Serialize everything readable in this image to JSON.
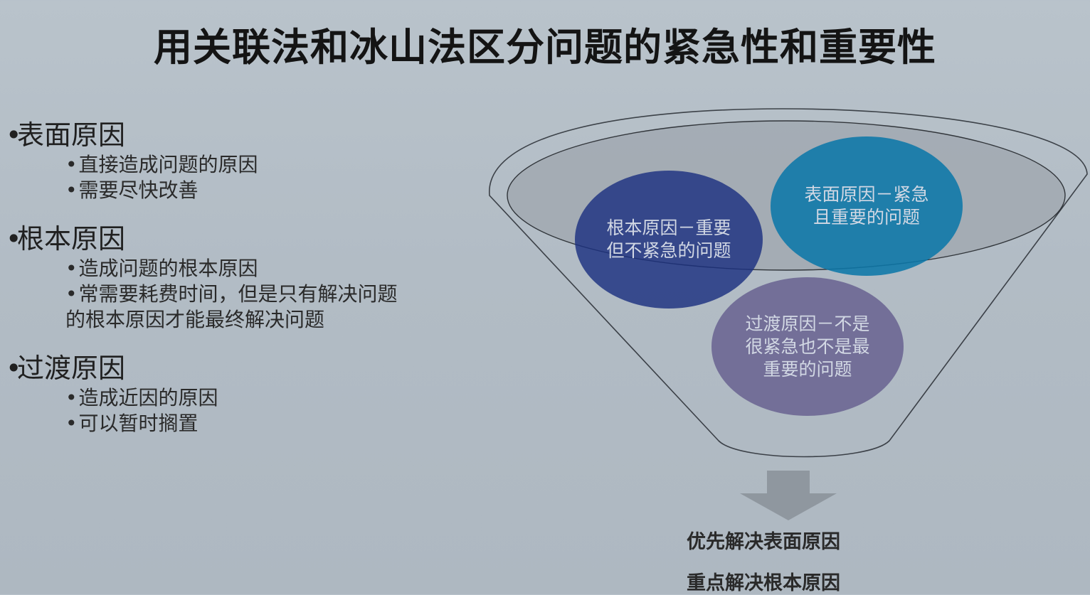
{
  "title": "用关联法和冰山法区分问题的紧急性和重要性",
  "sections": [
    {
      "heading": "表面原因",
      "points": [
        "直接造成问题的原因",
        "需要尽快改善"
      ]
    },
    {
      "heading": "根本原因",
      "points": [
        "造成问题的根本原因",
        "常需要耗费时间，但是只有解决问题"
      ],
      "continuation": "的根本原因才能最终解决问题"
    },
    {
      "heading": "过渡原因",
      "points": [
        "造成近因的原因",
        "可以暂时搁置"
      ]
    }
  ],
  "diagram": {
    "root_cause": "根本原因－重要但不紧急的问题",
    "surface_cause": "表面原因－紧急且重要的问题",
    "transitional_cause": "过渡原因－不是很紧急也不是最重要的问题"
  },
  "results": [
    "优先解决表面原因",
    "重点解决根本原因"
  ],
  "colors": {
    "background": "#b5bfc8",
    "root_circle": "#1c3180",
    "surface_circle": "#0c78a8",
    "transitional_circle": "#625a8c",
    "arrow": "#8f979f"
  }
}
